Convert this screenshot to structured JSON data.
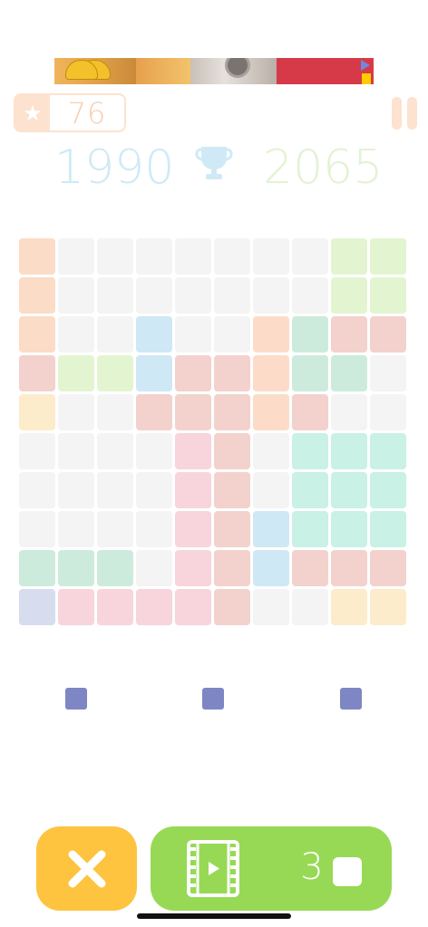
{
  "header": {
    "stars": "76",
    "score_current": "1990",
    "score_best": "2065"
  },
  "board": {
    "rows": 10,
    "cols": 10,
    "empty_color": "#f4f4f4",
    "cells": [
      [
        "#fbdcc6",
        null,
        null,
        null,
        null,
        null,
        null,
        null,
        "#e3f5d0",
        "#e3f5d0"
      ],
      [
        "#fbdcc6",
        null,
        null,
        null,
        null,
        null,
        null,
        null,
        "#e3f5d0",
        "#e3f5d0"
      ],
      [
        "#fbdcc6",
        null,
        null,
        "#cfe8f5",
        null,
        null,
        "#fcdcc8",
        "#cdebdd",
        "#f3d2cd",
        "#f3d2cd"
      ],
      [
        "#f3d2cd",
        "#e3f5d0",
        "#e3f5d0",
        "#cfe8f5",
        "#f3d2cd",
        "#f3d2cd",
        "#fcdcc8",
        "#cdebdd",
        "#cdebdd",
        null
      ],
      [
        "#fdeccb",
        null,
        null,
        "#f3d2cd",
        "#f3d2cd",
        "#f3d2cd",
        "#fcdcc8",
        "#f3d2cd",
        null,
        null
      ],
      [
        null,
        null,
        null,
        null,
        "#f8d4dc",
        "#f3d2cd",
        null,
        "#c9f1e6",
        "#c9f1e6",
        "#c9f1e6"
      ],
      [
        null,
        null,
        null,
        null,
        "#f8d4dc",
        "#f3d2cd",
        null,
        "#c9f1e6",
        "#c9f1e6",
        "#c9f1e6"
      ],
      [
        null,
        null,
        null,
        null,
        "#f8d4dc",
        "#f3d2cd",
        "#cfe8f5",
        "#c9f1e6",
        "#c9f1e6",
        "#c9f1e6"
      ],
      [
        "#cdebdd",
        "#cdebdd",
        "#cdebdd",
        null,
        "#f8d4dc",
        "#f3d2cd",
        "#cfe8f5",
        "#f3d2cd",
        "#f3d2cd",
        "#f3d2cd"
      ],
      [
        "#d8dcef",
        "#f8d4dc",
        "#f8d4dc",
        "#f8d4dc",
        "#f8d4dc",
        "#f3d2cd",
        null,
        null,
        "#fdeccb",
        "#fdeccb"
      ]
    ]
  },
  "pieces": {
    "color": "#7e86c4",
    "count": 3
  },
  "footer": {
    "cancel_icon": "close-icon",
    "video_icon": "film-play-icon",
    "reward_count": "3"
  },
  "colors": {
    "accent_cancel": "#fec33f",
    "accent_video": "#97d955"
  }
}
